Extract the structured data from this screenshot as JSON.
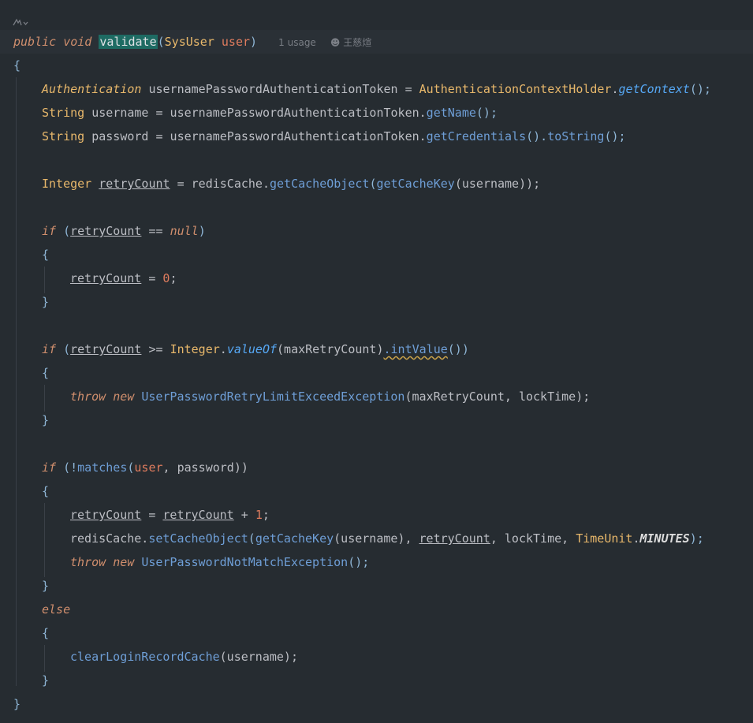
{
  "editor": {
    "usage_hint": "1 usage",
    "author": "王慈煊",
    "lines": {
      "sig_kw1": "public",
      "sig_kw2": "void",
      "sig_name": "validate",
      "sig_open": "(",
      "sig_type": "SysUser",
      "sig_param": "user",
      "sig_close": ")",
      "brace_open": "{",
      "l1_type": "Authentication",
      "l1_var": "usernamePasswordAuthenticationToken",
      "l1_eq": " = ",
      "l1_cls": "AuthenticationContextHolder",
      "l1_dot": ".",
      "l1_m": "getContext",
      "l1_end": "();",
      "l2_type": "String",
      "l2_var": " username = usernamePasswordAuthenticationToken.",
      "l2_m": "getName",
      "l2_end": "();",
      "l3_type": "String",
      "l3_var": " password = usernamePasswordAuthenticationToken.",
      "l3_m": "getCredentials",
      "l3_mid": "().",
      "l3_m2": "toString",
      "l3_end": "();",
      "l4_type": "Integer",
      "l4_var": "retryCount",
      "l4_rest": " = redisCache.",
      "l4_m": "getCacheObject",
      "l4_p": "(",
      "l4_m2": "getCacheKey",
      "l4_end": "(username));",
      "if1_kw": "if",
      "if1_open": " (",
      "if1_var": "retryCount",
      "if1_op": " == ",
      "if1_null": "null",
      "if1_close": ")",
      "ob": "{",
      "cb": "}",
      "a1_var": "retryCount",
      "a1_eq": " = ",
      "a1_num": "0",
      "a1_end": ";",
      "if2_kw": "if",
      "if2_open": " (",
      "if2_var": "retryCount",
      "if2_op": " >= ",
      "if2_type": "Integer",
      "if2_dot": ".",
      "if2_m": "valueOf",
      "if2_arg": "(maxRetryCount)",
      "if2_m2": ".intValue",
      "if2_end": "())",
      "t1_kw": "throw",
      "t1_new": "new",
      "t1_cls": "UserPasswordRetryLimitExceedException",
      "t1_args": "(maxRetryCount, lockTime);",
      "if3_kw": "if",
      "if3_open": " (!",
      "if3_m": "matches",
      "if3_p1": "(",
      "if3_user": "user",
      "if3_rest": ", password))",
      "b1_var": "retryCount",
      "b1_eq": " = ",
      "b1_var2": "retryCount",
      "b1_plus": " + ",
      "b1_num": "1",
      "b1_end": ";",
      "b2_obj": "redisCache.",
      "b2_m": "setCacheObject",
      "b2_p": "(",
      "b2_m2": "getCacheKey",
      "b2_a": "(username), ",
      "b2_var": "retryCount",
      "b2_b": ", lockTime, ",
      "b2_type": "TimeUnit",
      "b2_dot": ".",
      "b2_const": "MINUTES",
      "b2_end": ");",
      "t2_kw": "throw",
      "t2_new": "new",
      "t2_cls": "UserPasswordNotMatchException",
      "t2_end": "();",
      "else_kw": "else",
      "c1_m": "clearLoginRecordCache",
      "c1_end": "(username);",
      "brace_close": "}"
    }
  }
}
